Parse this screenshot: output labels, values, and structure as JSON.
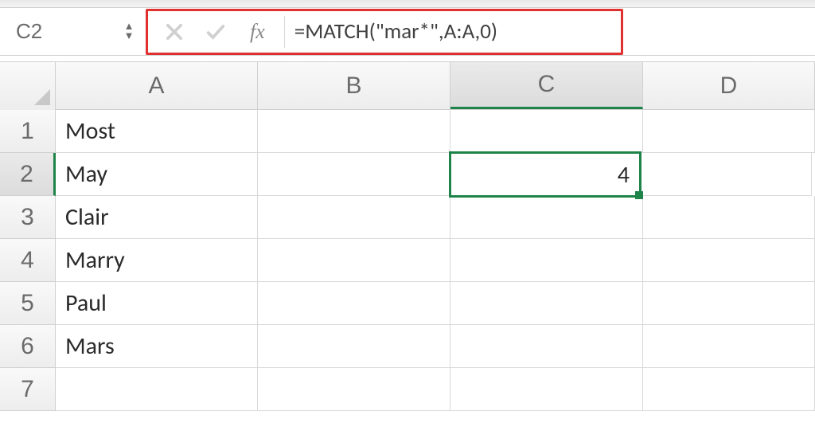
{
  "namebox": {
    "value": "C2"
  },
  "formulabar": {
    "fx_label": "fx",
    "formula": "=MATCH(\"mar*\",A:A,0)"
  },
  "columns": [
    "A",
    "B",
    "C",
    "D"
  ],
  "rows": [
    "1",
    "2",
    "3",
    "4",
    "5",
    "6",
    "7"
  ],
  "cells": {
    "A1": "Most",
    "A2": "May",
    "A3": "Clair",
    "A4": "Marry",
    "A5": "Paul",
    "A6": "Mars",
    "C2": "4"
  },
  "active": {
    "cell": "C2",
    "row": "2",
    "col": "C"
  }
}
